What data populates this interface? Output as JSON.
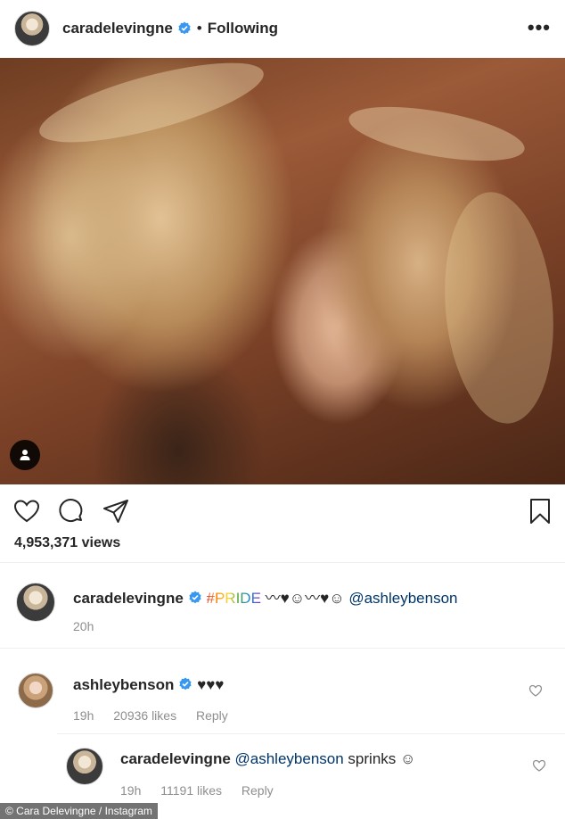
{
  "header": {
    "username": "caradelevingne",
    "separator": "•",
    "follow_status": "Following",
    "more_label": "•••"
  },
  "post": {
    "views": "4,953,371 views"
  },
  "caption": {
    "username": "caradelevingne",
    "hashtag": "#PRIDE",
    "emojis": "〰♥☺〰♥☺",
    "mention": "@ashleybenson",
    "time": "20h"
  },
  "comments": [
    {
      "username": "ashleybenson",
      "text": "♥♥♥",
      "time": "19h",
      "likes": "20936 likes",
      "reply": "Reply"
    },
    {
      "username": "caradelevingne",
      "mention": "@ashleybenson",
      "text": "sprinks ☺",
      "time": "19h",
      "likes": "11191 likes",
      "reply": "Reply"
    }
  ],
  "credit": "© Cara Delevingne / Instagram",
  "colors": {
    "verified": "#3897f0",
    "mention": "#003569",
    "meta": "#8e8e8e"
  }
}
